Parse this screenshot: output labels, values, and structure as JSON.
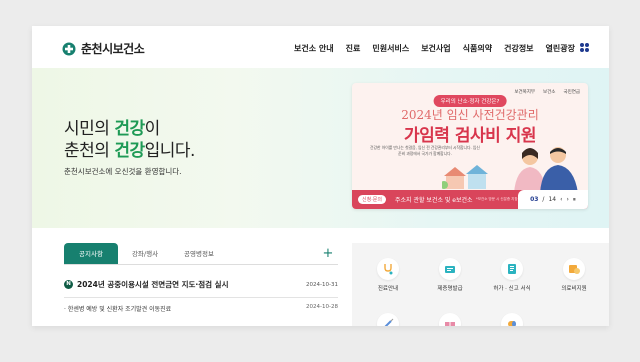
{
  "header": {
    "logo_text": "춘천시보건소",
    "nav": [
      "보건소 안내",
      "진료",
      "민원서비스",
      "보건사업",
      "식품의약",
      "건강정보",
      "열린광장"
    ]
  },
  "hero": {
    "line1_pre": "시민의 ",
    "line1_em": "건강",
    "line1_post": "이",
    "line2_pre": "춘천의 ",
    "line2_em": "건강",
    "line2_post": "입니다.",
    "subtitle": "춘천시보건소에 오신것을 환영합니다."
  },
  "banner": {
    "logos": [
      "보건복지부",
      "보건소",
      "국민연금"
    ],
    "pill": "우리의 난소·정자 건강은?",
    "line1": "2024년 임신 사전건강관리",
    "line2": "가임력 검사비 지원",
    "desc": "건강한 아이를 만나는 첫걸음, 임신 전 건강관리부터 시작합니다. 임신 준비 과정에서 국가가 함께합니다.",
    "tag": "신청·문의",
    "bottom_text": "주소지 관할 보건소 및 e보건소",
    "bottom_note": "*보건소 방문 시 신분증 지참",
    "current": "03",
    "total": "14"
  },
  "notice": {
    "tabs": [
      "공지사항",
      "강좌/행사",
      "공영병정보"
    ],
    "items": [
      {
        "badge": "N",
        "title": "2024년 공중이용시설 전면금연 지도·점검 실시",
        "date": "2024-10-31"
      },
      {
        "title": "· 한센병 예방 및 신환자 조기발견 이동진료",
        "date": "2024-10-28"
      }
    ]
  },
  "quick": {
    "items": [
      {
        "label": "진료안내",
        "icon": "stethoscope-icon",
        "color": "#f2a93b"
      },
      {
        "label": "제증명발급",
        "icon": "certificate-icon",
        "color": "#2bb3c0"
      },
      {
        "label": "허가 · 신고 서식",
        "icon": "document-icon",
        "color": "#2bb3c0"
      },
      {
        "label": "의료비지원",
        "icon": "money-icon",
        "color": "#f2a93b"
      },
      {
        "label": "",
        "icon": "syringe-icon",
        "color": "#5b8fd9"
      },
      {
        "label": "",
        "icon": "gift-icon",
        "color": "#e88aa7"
      },
      {
        "label": "",
        "icon": "medicine-icon",
        "color": "#f2a93b"
      }
    ]
  },
  "colors": {
    "brand_green": "#17806f",
    "accent_green": "#1e9a55",
    "banner_red": "#d9455b",
    "nav_blue": "#1f3a8f"
  }
}
